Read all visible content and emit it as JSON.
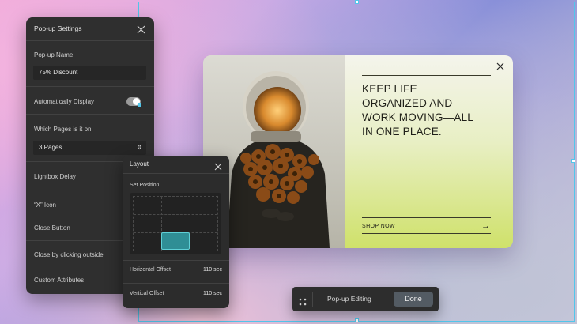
{
  "settings_panel": {
    "title": "Pop-up Settings",
    "popup_name_label": "Pop-up Name",
    "popup_name_value": "75% Discount",
    "auto_display_label": "Automatically Display",
    "auto_display_on": true,
    "pages_label": "Which Pages is it on",
    "pages_value": "3 Pages",
    "lightbox_delay_label": "Lightbox Delay",
    "x_icon_label": "“X” Icon",
    "close_button_label": "Close Button",
    "close_outside_label": "Close by clicking outside",
    "custom_attributes_label": "Custom Attributes"
  },
  "layout_panel": {
    "title": "Layout",
    "set_position_label": "Set Position",
    "selected_cell": "bottom-center",
    "horizontal_offset_label": "Horizontal Offset",
    "horizontal_offset_value": "110 sec",
    "vertical_offset_label": "Vertical Offset",
    "vertical_offset_value": "110 sec"
  },
  "popup": {
    "headline_lines": [
      "KEEP LIFE",
      "ORGANIZED AND",
      "WORK MOVING—ALL",
      "IN ONE PLACE."
    ],
    "cta_label": "SHOP NOW"
  },
  "bottom_bar": {
    "label": "Pop-up Editing",
    "done_label": "Done"
  },
  "colors": {
    "accent": "#52c6ea",
    "panel_bg": "#2f2f2f",
    "grid_selected": "#2f8e95",
    "popup_lime": "#cfe16a"
  }
}
